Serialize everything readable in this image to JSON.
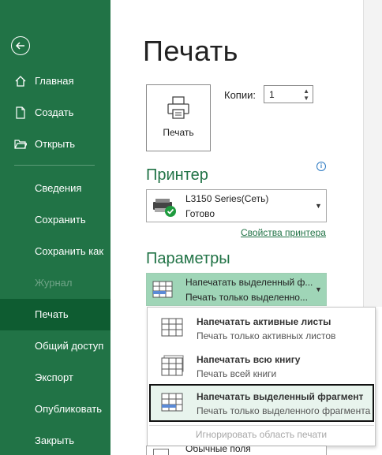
{
  "sidebar": {
    "items": [
      {
        "label": "Главная"
      },
      {
        "label": "Создать"
      },
      {
        "label": "Открыть"
      },
      {
        "label": "Сведения"
      },
      {
        "label": "Сохранить"
      },
      {
        "label": "Сохранить как"
      },
      {
        "label": "Журнал"
      },
      {
        "label": "Печать"
      },
      {
        "label": "Общий доступ"
      },
      {
        "label": "Экспорт"
      },
      {
        "label": "Опубликовать"
      },
      {
        "label": "Закрыть"
      }
    ],
    "active": "Печать",
    "disabled": "Журнал",
    "bg_color": "#217346",
    "active_color": "#0e5c31"
  },
  "main": {
    "title": "Печать",
    "print_button_label": "Печать",
    "copies_label": "Копии:",
    "copies_value": "1",
    "printer_section": "Принтер",
    "printer": {
      "name": "L3150 Series(Сеть)",
      "status": "Готово"
    },
    "printer_properties_link": "Свойства принтера",
    "settings_section": "Параметры",
    "print_what": {
      "title": "Напечатать выделенный ф...",
      "subtitle": "Печать только выделенно..."
    },
    "menu": {
      "items": [
        {
          "title": "Напечатать активные листы",
          "subtitle": "Печать только активных листов"
        },
        {
          "title": "Напечатать всю книгу",
          "subtitle": "Печать всей книги"
        },
        {
          "title": "Напечатать выделенный фрагмент",
          "subtitle": "Печать только выделенного фрагмента"
        }
      ],
      "ignore_print_area": "Игнорировать область печати"
    },
    "margins_label": "Обычные поля",
    "accent_color": "#217346",
    "selection_fill": "#9fd5b7"
  }
}
